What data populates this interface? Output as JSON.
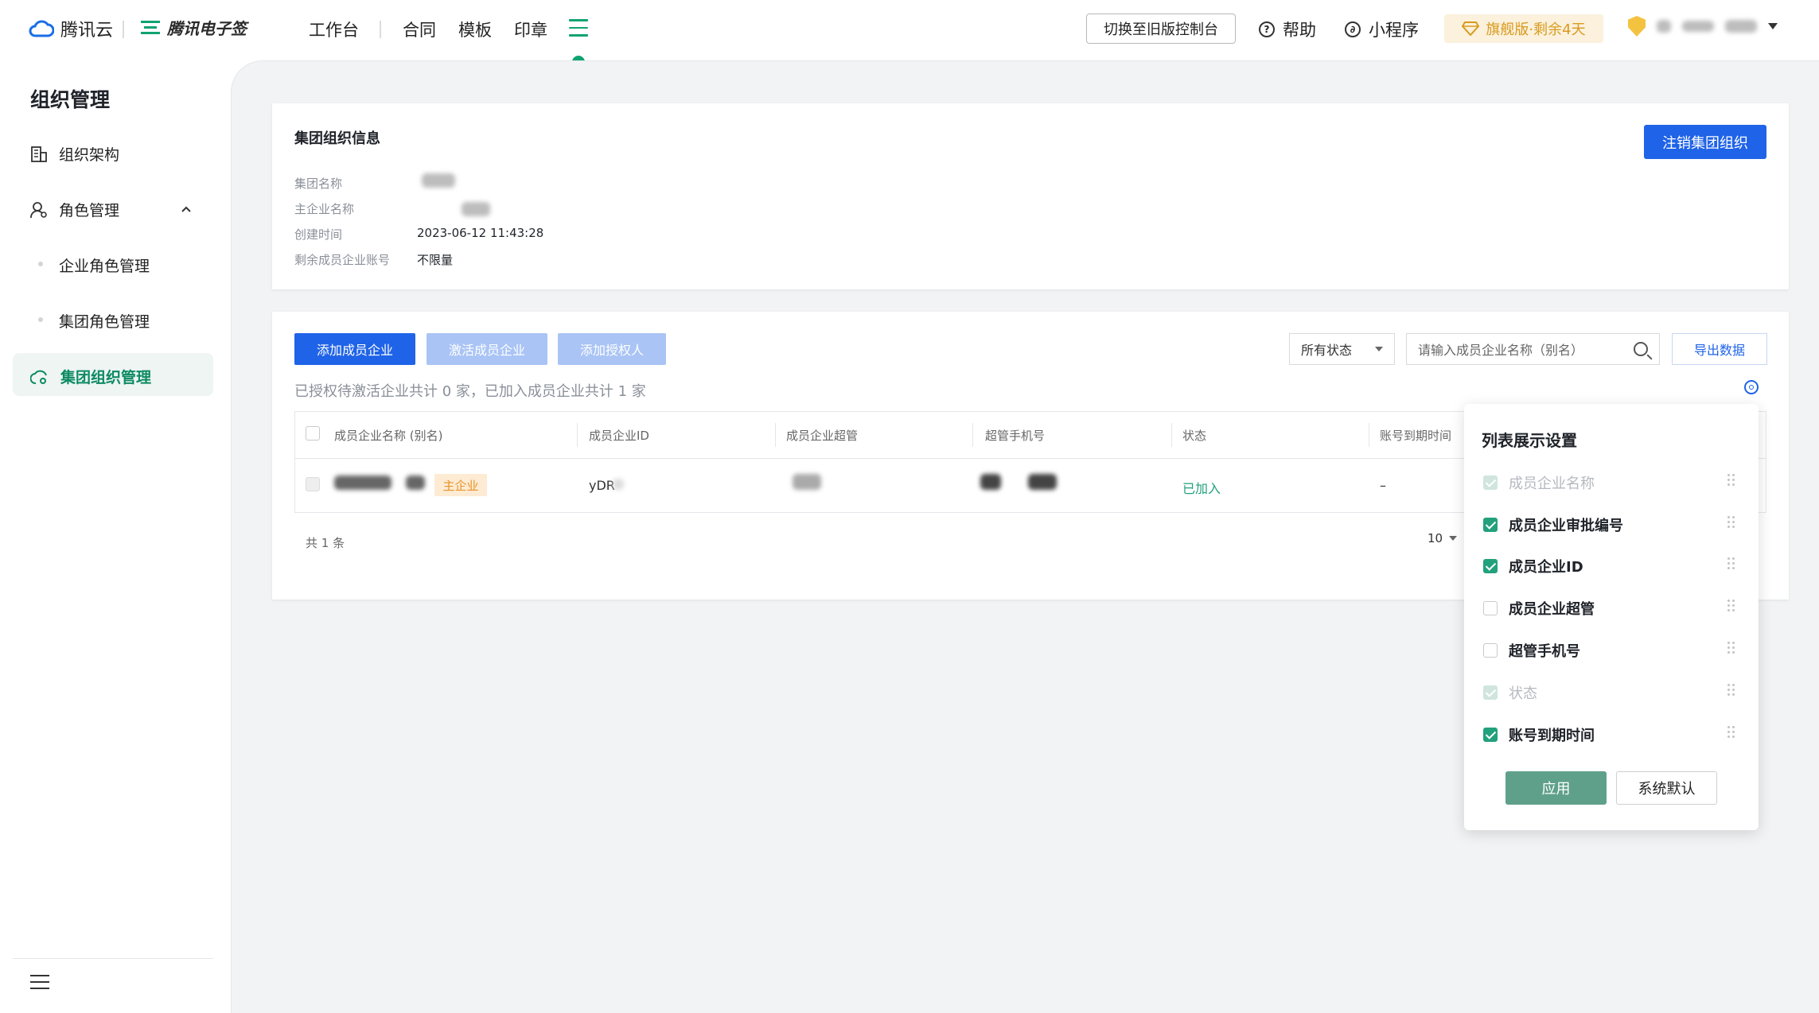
{
  "topbar": {
    "logo_tencent_cloud": "腾讯云",
    "logo_esign": "腾讯电子签",
    "nav": [
      "工作台",
      "合同",
      "模板",
      "印章"
    ],
    "switch_label": "切换至旧版控制台",
    "help_label": "帮助",
    "mini_program_label": "小程序",
    "vip_label": "旗舰版·剩余4天",
    "icons": {
      "menu": "hamburger-icon",
      "help": "question-circle-icon",
      "mini": "link-circle-icon",
      "vip": "diamond-icon",
      "shield": "shield-icon"
    },
    "accent": "#0fa371"
  },
  "sidebar": {
    "title": "组织管理",
    "items": [
      {
        "label": "组织架构",
        "icon": "building-icon"
      },
      {
        "label": "角色管理",
        "icon": "user-role-icon"
      },
      {
        "label": "企业角色管理"
      },
      {
        "label": "集团角色管理"
      },
      {
        "label": "集团组织管理",
        "icon": "cloud-org-icon",
        "active": true
      }
    ]
  },
  "group_info": {
    "title": "集团组织信息",
    "cancel_label": "注销集团组织",
    "fields": [
      {
        "label": "集团名称",
        "value": ""
      },
      {
        "label": "主企业名称",
        "value": ""
      },
      {
        "label": "创建时间",
        "value": "2023-06-12 11:43:28"
      },
      {
        "label": "剩余成员企业账号",
        "value": "不限量"
      }
    ]
  },
  "members": {
    "add_label": "添加成员企业",
    "activate_label": "激活成员企业",
    "add_auth_label": "添加授权人",
    "status_select": "所有状态",
    "search_placeholder": "请输入成员企业名称（别名）",
    "export_label": "导出数据",
    "summary": "已授权待激活企业共计 0 家，已加入成员企业共计 1 家",
    "columns": [
      "成员企业名称 (别名)",
      "成员企业ID",
      "成员企业超管",
      "超管手机号",
      "状态",
      "账号到期时间"
    ],
    "rows": [
      {
        "tag": "主企业",
        "id_prefix": "yDR",
        "status": "已加入",
        "expire": "–"
      }
    ],
    "total": "共 1 条",
    "page_size": "10",
    "primary_color": "#1f63e8",
    "success_color": "#22a17c"
  },
  "column_settings": {
    "title": "列表展示设置",
    "options": [
      {
        "label": "成员企业名称",
        "checked": true,
        "disabled": true
      },
      {
        "label": "成员企业审批编号",
        "checked": true,
        "disabled": false
      },
      {
        "label": "成员企业ID",
        "checked": true,
        "disabled": false
      },
      {
        "label": "成员企业超管",
        "checked": false,
        "disabled": false
      },
      {
        "label": "超管手机号",
        "checked": false,
        "disabled": false
      },
      {
        "label": "状态",
        "checked": true,
        "disabled": true
      },
      {
        "label": "账号到期时间",
        "checked": true,
        "disabled": false
      }
    ],
    "apply_label": "应用",
    "default_label": "系统默认"
  }
}
